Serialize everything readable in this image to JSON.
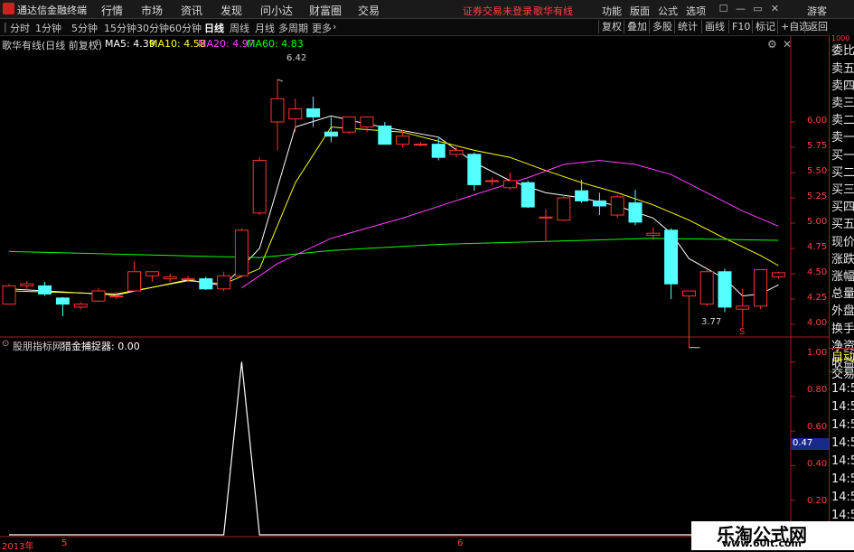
{
  "menu": {
    "app_title": "通达信金融终端",
    "items": [
      "行情",
      "市场",
      "资讯",
      "发现",
      "问小达",
      "财富圈",
      "交易"
    ],
    "status_warning": "证券交易未登录",
    "stock_name": "歌华有线",
    "right_items": [
      "功能",
      "版面",
      "公式",
      "选项"
    ],
    "guest": "游客"
  },
  "periods": [
    "分时",
    "1分钟",
    "5分钟",
    "15分钟",
    "30分钟",
    "60分钟",
    "日线",
    "周线",
    "月线",
    "多周期",
    "更多"
  ],
  "active_period": "日线",
  "right_tools": [
    "复权",
    "叠加",
    "多股",
    "统计",
    "画线",
    "F10",
    "标记",
    "+自选",
    "返回"
  ],
  "main_chart": {
    "title": "歌华有线(日线 前复权)",
    "ma": [
      {
        "label": "MA5: 4.39",
        "color": "#ffffff"
      },
      {
        "label": "MA10: 4.58",
        "color": "#ffff00"
      },
      {
        "label": "MA20: 4.97",
        "color": "#ff40ff"
      },
      {
        "label": "MA60: 4.83",
        "color": "#00ff00"
      }
    ],
    "high_label": "6.42",
    "low_label": "3.77",
    "y_ticks": [
      "6.00",
      "5.75",
      "5.50",
      "5.25",
      "5.00",
      "4.75",
      "4.50",
      "4.25",
      "4.00"
    ],
    "s_marker": "S"
  },
  "indicator": {
    "source": "股朋指标网",
    "name": "猎金捕捉器: 0.00",
    "y_ticks": [
      "1.00",
      "0.80",
      "0.60",
      "0.40",
      "0.20"
    ],
    "value_tag": "0.47"
  },
  "x_axis": {
    "year_label": "2013年",
    "labels": [
      "5",
      "6"
    ]
  },
  "right_panel": {
    "items": [
      "委比",
      "卖五",
      "卖四",
      "卖三",
      "卖二",
      "卖一",
      "买一",
      "买二",
      "买三",
      "买四",
      "买五",
      "现价",
      "涨跌",
      "涨幅",
      "总量",
      "外盘",
      "换手",
      "净资",
      "收益"
    ],
    "tabs": [
      "自动",
      "交易"
    ],
    "times": [
      "14:56",
      "14:56",
      "14:56",
      "14:56",
      "14:56",
      "14:56",
      "14:56",
      "14:56"
    ],
    "top_label": "1000"
  },
  "watermark": {
    "title": "乐淘公式网",
    "url": "www.60lt.com"
  },
  "chart_data": {
    "type": "candlestick",
    "title": "歌华有线(日线 前复权)",
    "ylim": [
      3.7,
      6.6
    ],
    "candles": [
      {
        "o": 4.2,
        "h": 4.4,
        "l": 4.2,
        "c": 4.38
      },
      {
        "o": 4.38,
        "h": 4.43,
        "l": 4.35,
        "c": 4.4
      },
      {
        "o": 4.38,
        "h": 4.42,
        "l": 4.28,
        "c": 4.3
      },
      {
        "o": 4.26,
        "h": 4.27,
        "l": 4.08,
        "c": 4.2
      },
      {
        "o": 4.17,
        "h": 4.22,
        "l": 4.15,
        "c": 4.2
      },
      {
        "o": 4.23,
        "h": 4.36,
        "l": 4.22,
        "c": 4.33
      },
      {
        "o": 4.28,
        "h": 4.32,
        "l": 4.25,
        "c": 4.28
      },
      {
        "o": 4.33,
        "h": 4.62,
        "l": 4.33,
        "c": 4.52
      },
      {
        "o": 4.48,
        "h": 4.52,
        "l": 4.42,
        "c": 4.52
      },
      {
        "o": 4.45,
        "h": 4.5,
        "l": 4.42,
        "c": 4.47
      },
      {
        "o": 4.45,
        "h": 4.48,
        "l": 4.42,
        "c": 4.45
      },
      {
        "o": 4.45,
        "h": 4.47,
        "l": 4.34,
        "c": 4.35
      },
      {
        "o": 4.35,
        "h": 4.52,
        "l": 4.33,
        "c": 4.48
      },
      {
        "o": 4.48,
        "h": 4.95,
        "l": 4.48,
        "c": 4.93
      },
      {
        "o": 5.1,
        "h": 5.65,
        "l": 5.08,
        "c": 5.62
      },
      {
        "o": 6.0,
        "h": 6.42,
        "l": 5.72,
        "c": 6.23
      },
      {
        "o": 6.03,
        "h": 6.23,
        "l": 5.9,
        "c": 6.13
      },
      {
        "o": 6.13,
        "h": 6.25,
        "l": 5.95,
        "c": 6.05
      },
      {
        "o": 5.9,
        "h": 6.05,
        "l": 5.8,
        "c": 5.86
      },
      {
        "o": 5.9,
        "h": 6.05,
        "l": 5.88,
        "c": 6.05
      },
      {
        "o": 5.95,
        "h": 6.05,
        "l": 5.9,
        "c": 6.05
      },
      {
        "o": 5.96,
        "h": 6.0,
        "l": 5.78,
        "c": 5.78
      },
      {
        "o": 5.78,
        "h": 5.92,
        "l": 5.75,
        "c": 5.86
      },
      {
        "o": 5.78,
        "h": 5.8,
        "l": 5.76,
        "c": 5.78
      },
      {
        "o": 5.78,
        "h": 5.84,
        "l": 5.62,
        "c": 5.65
      },
      {
        "o": 5.68,
        "h": 5.75,
        "l": 5.65,
        "c": 5.72
      },
      {
        "o": 5.68,
        "h": 5.7,
        "l": 5.32,
        "c": 5.38
      },
      {
        "o": 5.42,
        "h": 5.45,
        "l": 5.37,
        "c": 5.42
      },
      {
        "o": 5.35,
        "h": 5.5,
        "l": 5.33,
        "c": 5.42
      },
      {
        "o": 5.4,
        "h": 5.42,
        "l": 5.15,
        "c": 5.16
      },
      {
        "o": 5.06,
        "h": 5.14,
        "l": 4.82,
        "c": 5.06
      },
      {
        "o": 5.03,
        "h": 5.28,
        "l": 5.02,
        "c": 5.25
      },
      {
        "o": 5.32,
        "h": 5.43,
        "l": 5.2,
        "c": 5.22
      },
      {
        "o": 5.22,
        "h": 5.3,
        "l": 5.08,
        "c": 5.17
      },
      {
        "o": 5.08,
        "h": 5.28,
        "l": 5.05,
        "c": 5.26
      },
      {
        "o": 5.2,
        "h": 5.33,
        "l": 4.98,
        "c": 5.01
      },
      {
        "o": 4.88,
        "h": 4.96,
        "l": 4.83,
        "c": 4.9
      },
      {
        "o": 4.93,
        "h": 4.95,
        "l": 4.25,
        "c": 4.4
      },
      {
        "o": 4.28,
        "h": 4.33,
        "l": 3.77,
        "c": 4.33
      },
      {
        "o": 4.2,
        "h": 4.54,
        "l": 4.18,
        "c": 4.52
      },
      {
        "o": 4.52,
        "h": 4.55,
        "l": 4.12,
        "c": 4.17
      },
      {
        "o": 4.15,
        "h": 4.35,
        "l": 3.97,
        "c": 4.18
      },
      {
        "o": 4.18,
        "h": 4.54,
        "l": 4.15,
        "c": 4.54
      },
      {
        "o": 4.47,
        "h": 4.52,
        "l": 4.45,
        "c": 4.51
      }
    ],
    "ma_lines": [
      {
        "name": "MA5",
        "color": "#ffffff",
        "points": [
          [
            0,
            4.35
          ],
          [
            6,
            4.29
          ],
          [
            10,
            4.44
          ],
          [
            12,
            4.38
          ],
          [
            14,
            4.75
          ],
          [
            16,
            5.95
          ],
          [
            18,
            6.06
          ],
          [
            20,
            5.98
          ],
          [
            24,
            5.85
          ],
          [
            26,
            5.6
          ],
          [
            28,
            5.42
          ],
          [
            30,
            5.3
          ],
          [
            32,
            5.25
          ],
          [
            34,
            5.17
          ],
          [
            36,
            5.05
          ],
          [
            37,
            4.9
          ],
          [
            38,
            4.65
          ],
          [
            40,
            4.45
          ],
          [
            41,
            4.28
          ],
          [
            42,
            4.3
          ],
          [
            43,
            4.39
          ]
        ]
      },
      {
        "name": "MA10",
        "color": "#ffff00",
        "points": [
          [
            0,
            4.33
          ],
          [
            6,
            4.3
          ],
          [
            10,
            4.43
          ],
          [
            12,
            4.4
          ],
          [
            14,
            4.55
          ],
          [
            16,
            5.4
          ],
          [
            18,
            5.95
          ],
          [
            22,
            5.9
          ],
          [
            26,
            5.72
          ],
          [
            28,
            5.65
          ],
          [
            30,
            5.52
          ],
          [
            32,
            5.4
          ],
          [
            34,
            5.3
          ],
          [
            36,
            5.18
          ],
          [
            38,
            5.03
          ],
          [
            40,
            4.85
          ],
          [
            42,
            4.68
          ],
          [
            43,
            4.58
          ]
        ]
      },
      {
        "name": "MA20",
        "color": "#ff40ff",
        "points": [
          [
            13,
            4.36
          ],
          [
            15,
            4.6
          ],
          [
            18,
            4.85
          ],
          [
            22,
            5.05
          ],
          [
            26,
            5.28
          ],
          [
            29,
            5.45
          ],
          [
            31,
            5.58
          ],
          [
            33,
            5.62
          ],
          [
            35,
            5.58
          ],
          [
            37,
            5.48
          ],
          [
            39,
            5.3
          ],
          [
            41,
            5.12
          ],
          [
            43,
            4.97
          ]
        ]
      },
      {
        "name": "MA60",
        "color": "#00ff00",
        "points": [
          [
            0,
            4.72
          ],
          [
            14,
            4.66
          ],
          [
            18,
            4.73
          ],
          [
            24,
            4.79
          ],
          [
            30,
            4.82
          ],
          [
            36,
            4.85
          ],
          [
            43,
            4.83
          ]
        ]
      }
    ],
    "indicator": {
      "name": "猎金捕捉器",
      "ylim": [
        0,
        1.05
      ],
      "values": [
        0,
        0,
        0,
        0,
        0,
        0,
        0,
        0,
        0,
        0,
        0,
        0,
        0,
        1,
        0,
        0,
        0,
        0,
        0,
        0,
        0,
        0,
        0,
        0,
        0,
        0,
        0,
        0,
        0,
        0,
        0,
        0,
        0,
        0,
        0,
        0,
        0,
        0,
        0,
        0,
        0,
        0,
        0,
        0
      ]
    }
  }
}
